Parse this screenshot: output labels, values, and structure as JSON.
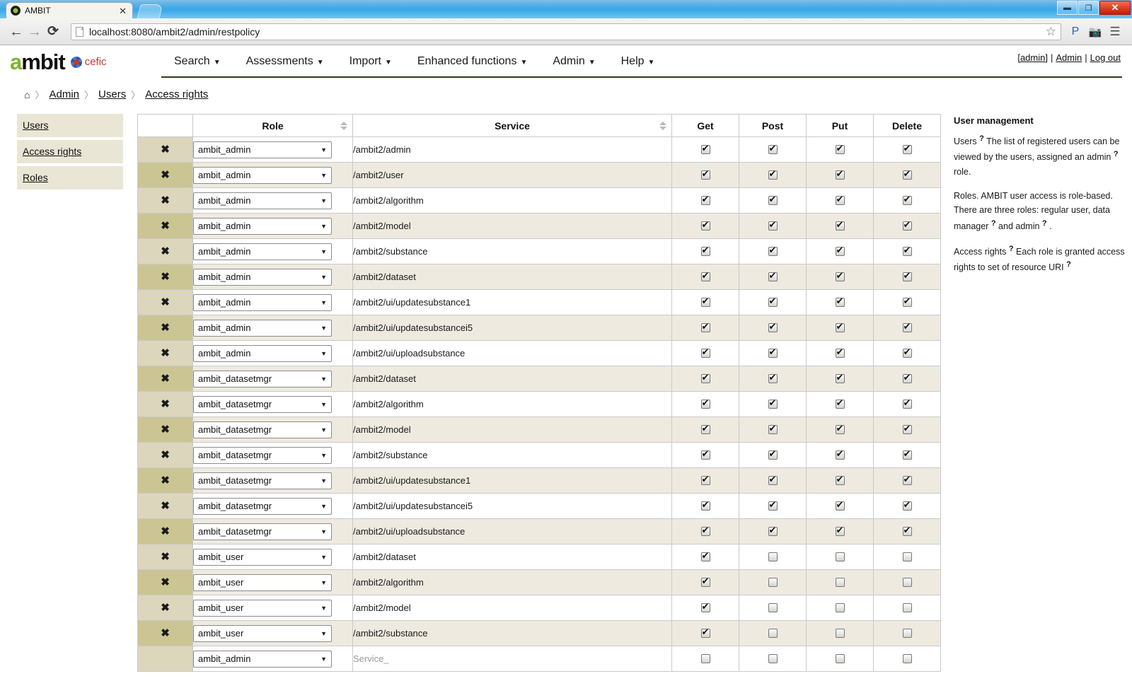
{
  "browser": {
    "tab_title": "AMBIT",
    "tab_close": "✕",
    "back_icon": "←",
    "forward_icon": "→",
    "reload_icon": "⟳",
    "url": "localhost:8080/ambit2/admin/restpolicy",
    "star_icon": "☆",
    "extension_p": "P",
    "extension_cam": "📷",
    "menu_icon": "☰",
    "minimize": "▬",
    "maximize": "❐",
    "close": "✕"
  },
  "header": {
    "logo_a": "a",
    "logo_rest": "mbit",
    "cefic_text": "cefic",
    "nav": [
      {
        "label": "Search",
        "caret": "▼"
      },
      {
        "label": "Assessments",
        "caret": "▼"
      },
      {
        "label": "Import",
        "caret": "▼"
      },
      {
        "label": "Enhanced functions",
        "caret": "▼"
      },
      {
        "label": "Admin",
        "caret": "▼"
      },
      {
        "label": "Help",
        "caret": "▼"
      }
    ],
    "user": "[admin]",
    "admin_link": "Admin",
    "logout_link": "Log out",
    "sep": "|"
  },
  "breadcrumb": {
    "home_icon": "⌂",
    "sep": "〉",
    "items": [
      "Admin",
      "Users",
      "Access rights"
    ]
  },
  "sidebar": {
    "items": [
      {
        "label": "Users"
      },
      {
        "label": "Access rights"
      },
      {
        "label": "Roles"
      }
    ]
  },
  "table": {
    "columns": [
      "",
      "Role",
      "Service",
      "Get",
      "Post",
      "Put",
      "Delete"
    ],
    "delete_glyph": "✖",
    "select_caret": "▼",
    "service_placeholder": "Service_",
    "rows": [
      {
        "role": "ambit_admin",
        "service": "/ambit2/admin",
        "get": true,
        "post": true,
        "put": true,
        "delete": true,
        "deletable": true
      },
      {
        "role": "ambit_admin",
        "service": "/ambit2/user",
        "get": true,
        "post": true,
        "put": true,
        "delete": true,
        "deletable": true
      },
      {
        "role": "ambit_admin",
        "service": "/ambit2/algorithm",
        "get": true,
        "post": true,
        "put": true,
        "delete": true,
        "deletable": true
      },
      {
        "role": "ambit_admin",
        "service": "/ambit2/model",
        "get": true,
        "post": true,
        "put": true,
        "delete": true,
        "deletable": true
      },
      {
        "role": "ambit_admin",
        "service": "/ambit2/substance",
        "get": true,
        "post": true,
        "put": true,
        "delete": true,
        "deletable": true
      },
      {
        "role": "ambit_admin",
        "service": "/ambit2/dataset",
        "get": true,
        "post": true,
        "put": true,
        "delete": true,
        "deletable": true
      },
      {
        "role": "ambit_admin",
        "service": "/ambit2/ui/updatesubstance1",
        "get": true,
        "post": true,
        "put": true,
        "delete": true,
        "deletable": true
      },
      {
        "role": "ambit_admin",
        "service": "/ambit2/ui/updatesubstancei5",
        "get": true,
        "post": true,
        "put": true,
        "delete": true,
        "deletable": true
      },
      {
        "role": "ambit_admin",
        "service": "/ambit2/ui/uploadsubstance",
        "get": true,
        "post": true,
        "put": true,
        "delete": true,
        "deletable": true
      },
      {
        "role": "ambit_datasetmgr",
        "service": "/ambit2/dataset",
        "get": true,
        "post": true,
        "put": true,
        "delete": true,
        "deletable": true
      },
      {
        "role": "ambit_datasetmgr",
        "service": "/ambit2/algorithm",
        "get": true,
        "post": true,
        "put": true,
        "delete": true,
        "deletable": true
      },
      {
        "role": "ambit_datasetmgr",
        "service": "/ambit2/model",
        "get": true,
        "post": true,
        "put": true,
        "delete": true,
        "deletable": true
      },
      {
        "role": "ambit_datasetmgr",
        "service": "/ambit2/substance",
        "get": true,
        "post": true,
        "put": true,
        "delete": true,
        "deletable": true
      },
      {
        "role": "ambit_datasetmgr",
        "service": "/ambit2/ui/updatesubstance1",
        "get": true,
        "post": true,
        "put": true,
        "delete": true,
        "deletable": true
      },
      {
        "role": "ambit_datasetmgr",
        "service": "/ambit2/ui/updatesubstancei5",
        "get": true,
        "post": true,
        "put": true,
        "delete": true,
        "deletable": true
      },
      {
        "role": "ambit_datasetmgr",
        "service": "/ambit2/ui/uploadsubstance",
        "get": true,
        "post": true,
        "put": true,
        "delete": true,
        "deletable": true
      },
      {
        "role": "ambit_user",
        "service": "/ambit2/dataset",
        "get": true,
        "post": false,
        "put": false,
        "delete": false,
        "deletable": true
      },
      {
        "role": "ambit_user",
        "service": "/ambit2/algorithm",
        "get": true,
        "post": false,
        "put": false,
        "delete": false,
        "deletable": true
      },
      {
        "role": "ambit_user",
        "service": "/ambit2/model",
        "get": true,
        "post": false,
        "put": false,
        "delete": false,
        "deletable": true
      },
      {
        "role": "ambit_user",
        "service": "/ambit2/substance",
        "get": true,
        "post": false,
        "put": false,
        "delete": false,
        "deletable": true
      },
      {
        "role": "ambit_admin",
        "service": "",
        "get": false,
        "post": false,
        "put": false,
        "delete": false,
        "deletable": false,
        "is_new": true
      }
    ]
  },
  "help": {
    "title": "User management",
    "p1_a": "Users",
    "p1_b": "The list of registered users can be viewed by the users, assigned an admin",
    "p1_c": "role.",
    "p2": "Roles. AMBIT user access is role-based. There are three roles: regular user, data manager",
    "p2_b": "and admin",
    "p2_c": ".",
    "p3_a": "Access rights",
    "p3_b": "Each role is granted access rights to set of resource URI",
    "q_glyph": "?"
  }
}
